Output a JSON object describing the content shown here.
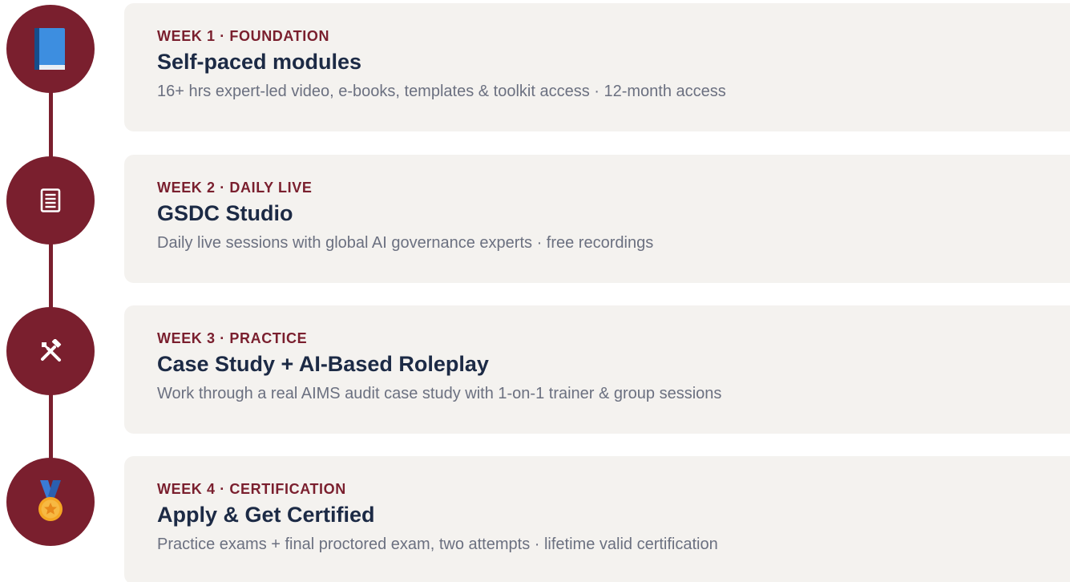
{
  "theme": {
    "accent": "#7a1f2e",
    "title_color": "#1c2a45",
    "desc_color": "#6b7080",
    "card_bg": "#f4f2ef"
  },
  "steps": [
    {
      "icon": "book-icon",
      "label": "WEEK 1 · FOUNDATION",
      "title": "Self-paced modules",
      "description": "16+ hrs expert-led video, e-books, templates & toolkit access · 12-month access"
    },
    {
      "icon": "desktop-computer-icon",
      "label": "WEEK 2 · DAILY LIVE",
      "title": "GSDC Studio",
      "description": "Daily live sessions with global AI governance experts · free recordings"
    },
    {
      "icon": "tools-icon",
      "label": "WEEK 3 · PRACTICE",
      "title": "Case Study + AI-Based Roleplay",
      "description": "Work through a real AIMS audit case study with 1-on-1 trainer & group sessions"
    },
    {
      "icon": "medal-icon",
      "label": "WEEK 4 · CERTIFICATION",
      "title": "Apply & Get Certified",
      "description": "Practice exams + final proctored exam, two attempts · lifetime valid certification"
    }
  ]
}
